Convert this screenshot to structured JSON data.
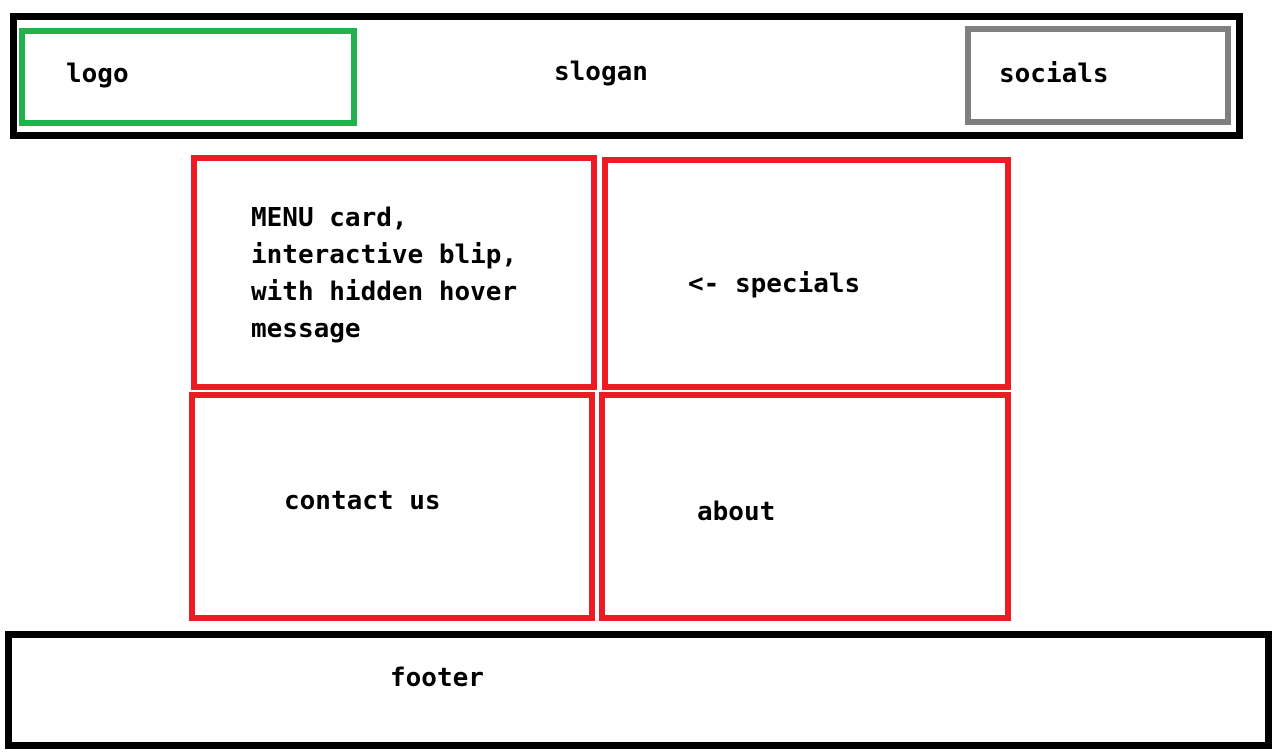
{
  "header": {
    "logo_label": "logo",
    "slogan_label": "slogan",
    "socials_label": "socials"
  },
  "cards": {
    "menu_lines": [
      "MENU card,",
      "interactive blip,",
      "with hidden hover",
      "message"
    ],
    "specials_label": "<- specials",
    "contact_label": "contact us",
    "about_label": "about"
  },
  "footer": {
    "label": "footer"
  },
  "colors": {
    "outline": "#000000",
    "logo_outline": "#22b14c",
    "socials_outline": "#7f7f7f",
    "card_outline": "#ed1c24"
  }
}
